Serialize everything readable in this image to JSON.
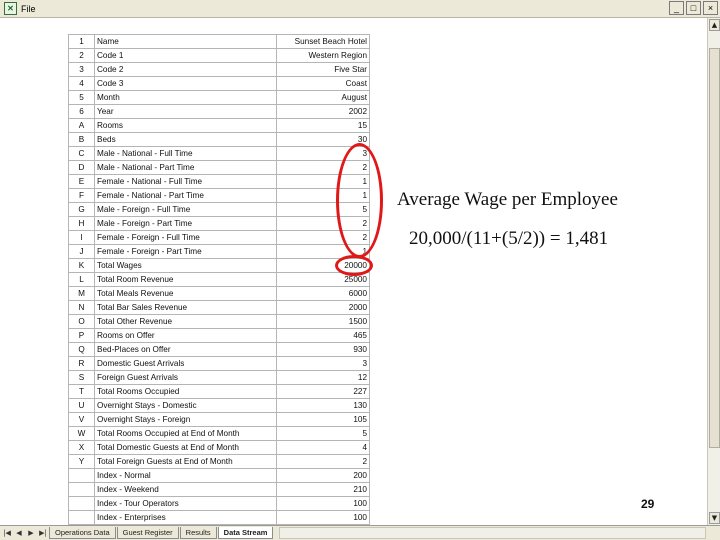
{
  "window": {
    "app_icon": "excel-icon",
    "menu_file": "File",
    "min_label": "_",
    "max_label": "□",
    "close_label": "×"
  },
  "table": {
    "rows": [
      {
        "code": "1",
        "name": "Name",
        "value": "Sunset Beach Hotel"
      },
      {
        "code": "2",
        "name": "Code 1",
        "value": "Western Region"
      },
      {
        "code": "3",
        "name": "Code 2",
        "value": "Five Star"
      },
      {
        "code": "4",
        "name": "Code 3",
        "value": "Coast"
      },
      {
        "code": "5",
        "name": "Month",
        "value": "August"
      },
      {
        "code": "6",
        "name": "Year",
        "value": "2002"
      },
      {
        "code": "A",
        "name": "Rooms",
        "value": "15"
      },
      {
        "code": "B",
        "name": "Beds",
        "value": "30"
      },
      {
        "code": "C",
        "name": "Male - National - Full Time",
        "value": "3"
      },
      {
        "code": "D",
        "name": "Male - National - Part Time",
        "value": "2"
      },
      {
        "code": "E",
        "name": "Female - National - Full Time",
        "value": "1"
      },
      {
        "code": "F",
        "name": "Female - National - Part Time",
        "value": "1"
      },
      {
        "code": "G",
        "name": "Male - Foreign - Full Time",
        "value": "5"
      },
      {
        "code": "H",
        "name": "Male - Foreign - Part Time",
        "value": "2"
      },
      {
        "code": "I",
        "name": "Female - Foreign - Full Time",
        "value": "2"
      },
      {
        "code": "J",
        "name": "Female - Foreign - Part Time",
        "value": "1"
      },
      {
        "code": "K",
        "name": "Total Wages",
        "value": "20000"
      },
      {
        "code": "L",
        "name": "Total Room Revenue",
        "value": "25000"
      },
      {
        "code": "M",
        "name": "Total Meals Revenue",
        "value": "6000"
      },
      {
        "code": "N",
        "name": "Total Bar Sales Revenue",
        "value": "2000"
      },
      {
        "code": "O",
        "name": "Total Other Revenue",
        "value": "1500"
      },
      {
        "code": "P",
        "name": "Rooms on Offer",
        "value": "465"
      },
      {
        "code": "Q",
        "name": "Bed-Places on Offer",
        "value": "930"
      },
      {
        "code": "R",
        "name": "Domestic Guest Arrivals",
        "value": "3"
      },
      {
        "code": "S",
        "name": "Foreign Guest Arrivals",
        "value": "12"
      },
      {
        "code": "T",
        "name": "Total Rooms Occupied",
        "value": "227"
      },
      {
        "code": "U",
        "name": "Overnight Stays - Domestic",
        "value": "130"
      },
      {
        "code": "V",
        "name": "Overnight Stays - Foreign",
        "value": "105"
      },
      {
        "code": "W",
        "name": "Total Rooms Occupied at End of Month",
        "value": "5"
      },
      {
        "code": "X",
        "name": "Total Domestic Guests at End of Month",
        "value": "4"
      },
      {
        "code": "Y",
        "name": "Total Foreign Guests at End of Month",
        "value": "2"
      },
      {
        "code": "",
        "name": "Index - Normal",
        "value": "200"
      },
      {
        "code": "",
        "name": "Index - Weekend",
        "value": "210"
      },
      {
        "code": "",
        "name": "Index - Tour Operators",
        "value": "100"
      },
      {
        "code": "",
        "name": "Index - Enterprises",
        "value": "100"
      }
    ]
  },
  "annotation": {
    "title": "Average Wage per Employee",
    "formula": "20,000/(11+(5/2)) = 1,481",
    "page_number": "29",
    "highlight_color": "#e01818"
  },
  "sheet_tabs": {
    "nav_icons": [
      "first-sheet-icon",
      "prev-sheet-icon",
      "next-sheet-icon",
      "last-sheet-icon"
    ],
    "tabs": [
      {
        "label": "Operations Data",
        "active": false
      },
      {
        "label": "Guest Register",
        "active": false
      },
      {
        "label": "Results",
        "active": false
      },
      {
        "label": "Data Stream",
        "active": true
      }
    ]
  }
}
